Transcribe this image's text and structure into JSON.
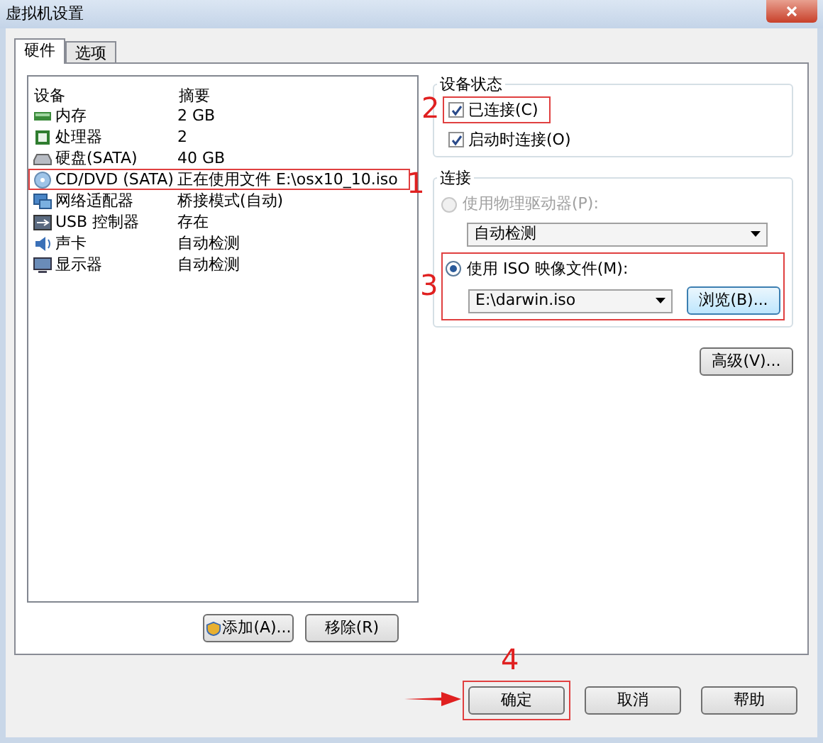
{
  "window": {
    "title": "虚拟机设置"
  },
  "tabs": [
    {
      "label": "硬件",
      "selected": true
    },
    {
      "label": "选项",
      "selected": false
    }
  ],
  "device_list": {
    "columns": [
      "设备",
      "摘要"
    ],
    "rows": [
      {
        "kind": "memory",
        "device": "内存",
        "summary": "2 GB"
      },
      {
        "kind": "cpu",
        "device": "处理器",
        "summary": "2"
      },
      {
        "kind": "disk",
        "device": "硬盘(SATA)",
        "summary": "40 GB"
      },
      {
        "kind": "cd",
        "device": "CD/DVD (SATA)",
        "summary": "正在使用文件 E:\\osx10_10.iso",
        "annotation": "1"
      },
      {
        "kind": "network",
        "device": "网络适配器",
        "summary": "桥接模式(自动)"
      },
      {
        "kind": "usb",
        "device": "USB 控制器",
        "summary": "存在"
      },
      {
        "kind": "sound",
        "device": "声卡",
        "summary": "自动检测"
      },
      {
        "kind": "display",
        "device": "显示器",
        "summary": "自动检测"
      }
    ]
  },
  "list_buttons": [
    "添加(A)...",
    "移除(R)"
  ],
  "device_status": {
    "title": "设备状态",
    "connected": {
      "label": "已连接(C)",
      "checked": true,
      "annotation": "2"
    },
    "connect_at_power_on": {
      "label": "启动时连接(O)",
      "checked": true
    }
  },
  "connection": {
    "title": "连接",
    "physical": {
      "label": "使用物理驱动器(P):",
      "selected": false,
      "disabled": true,
      "value": "自动检测"
    },
    "iso": {
      "label": "使用 ISO 映像文件(M):",
      "selected": true,
      "value": "E:\\darwin.iso",
      "browse": "浏览(B)...",
      "annotation": "3"
    },
    "advanced": "高级(V)..."
  },
  "dialog_buttons": [
    {
      "label": "确定",
      "annotation": "4"
    },
    {
      "label": "取消"
    },
    {
      "label": "帮助"
    }
  ]
}
